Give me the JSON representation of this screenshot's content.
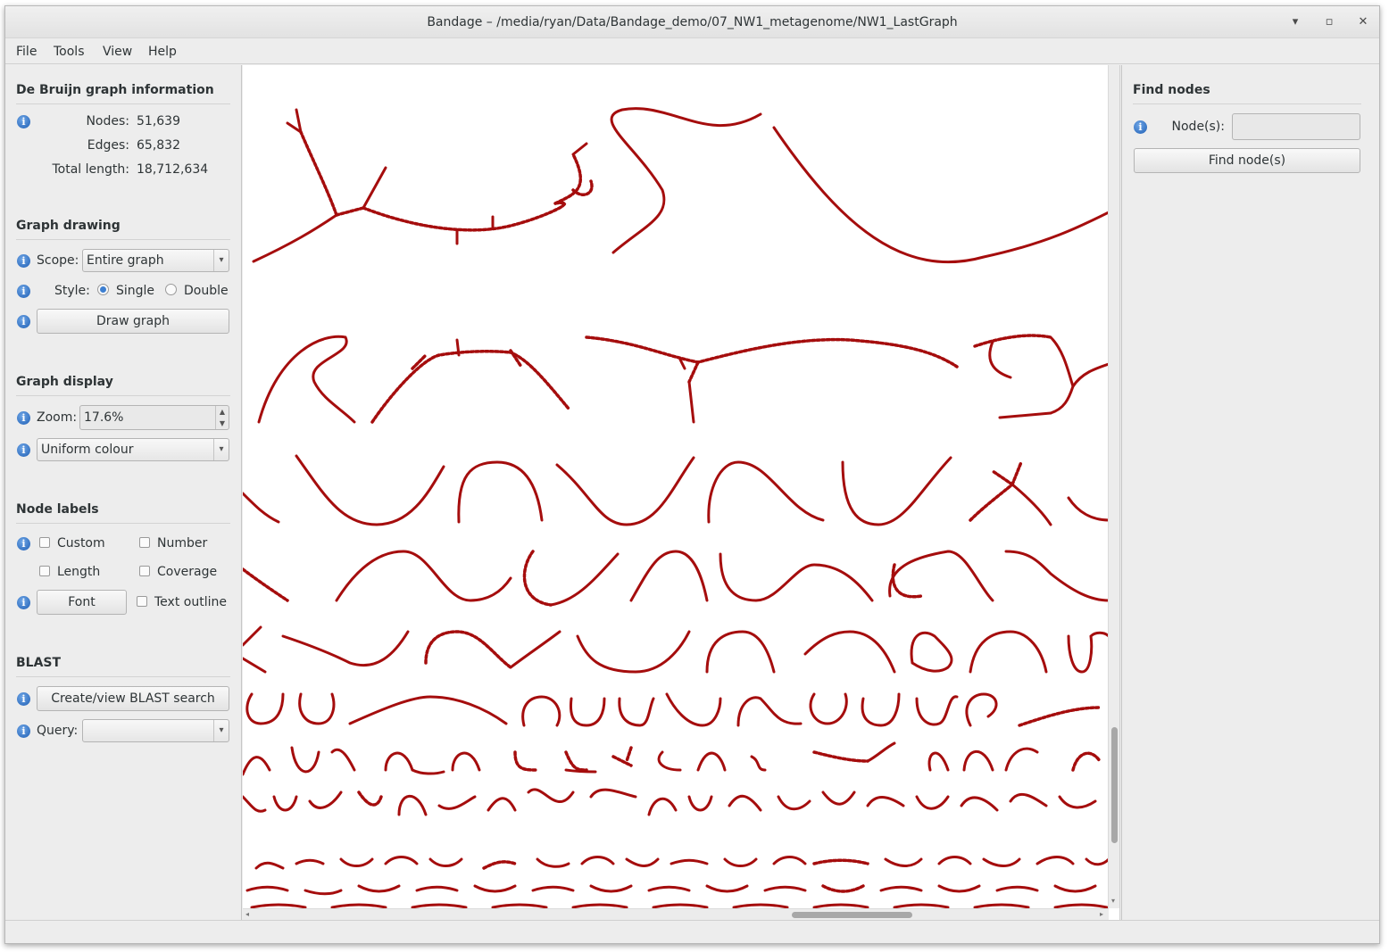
{
  "window": {
    "title": "Bandage – /media/ryan/Data/Bandage_demo/07_NW1_metagenome/NW1_LastGraph",
    "minimize": "▾",
    "maximize": "▫",
    "close": "✕"
  },
  "menu": {
    "file": "File",
    "tools": "Tools",
    "view": "View",
    "help": "Help"
  },
  "graph_info": {
    "title": "De Bruijn graph information",
    "nodes_label": "Nodes:",
    "nodes_value": "51,639",
    "edges_label": "Edges:",
    "edges_value": "65,832",
    "length_label": "Total length:",
    "length_value": "18,712,634"
  },
  "graph_drawing": {
    "title": "Graph drawing",
    "scope_label": "Scope:",
    "scope_value": "Entire graph",
    "style_label": "Style:",
    "style_single": "Single",
    "style_double": "Double",
    "style_selected": "Single",
    "draw_button": "Draw graph"
  },
  "graph_display": {
    "title": "Graph display",
    "zoom_label": "Zoom:",
    "zoom_value": "17.6%",
    "colour_value": "Uniform colour"
  },
  "node_labels": {
    "title": "Node labels",
    "custom": "Custom",
    "number": "Number",
    "length": "Length",
    "coverage": "Coverage",
    "font_button": "Font",
    "text_outline": "Text outline"
  },
  "blast": {
    "title": "BLAST",
    "search_button": "Create/view BLAST search",
    "query_label": "Query:",
    "query_value": ""
  },
  "find_nodes": {
    "title": "Find nodes",
    "nodes_label": "Node(s):",
    "nodes_value": "",
    "find_button": "Find node(s)"
  },
  "icons": {
    "info": "i",
    "combo_arrow": "▾",
    "spin_up": "▲",
    "spin_down": "▼",
    "scroll_left": "◂",
    "scroll_right": "▸",
    "scroll_down": "▾"
  },
  "colors": {
    "node_color": "#a50d0d",
    "info_icon": "#1f5fb5"
  }
}
